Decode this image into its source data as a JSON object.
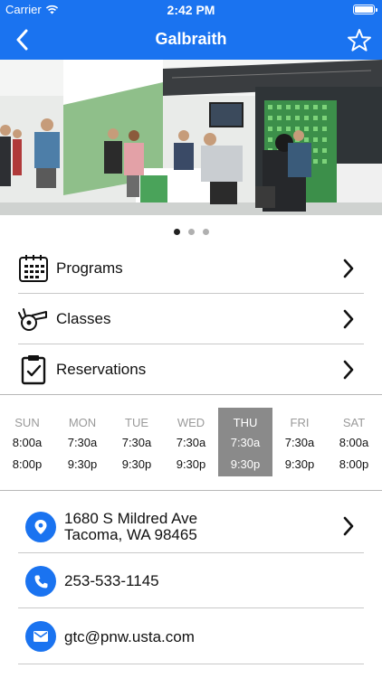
{
  "status_bar": {
    "carrier": "Carrier",
    "time": "2:42 PM"
  },
  "nav": {
    "title": "Galbraith",
    "back_icon": "chevron-left-icon",
    "favorite_icon": "star-outline-icon"
  },
  "gallery": {
    "photo_count": 3,
    "active_index": 0
  },
  "menu": [
    {
      "label": "Programs",
      "icon": "calendar-icon"
    },
    {
      "label": "Classes",
      "icon": "whistle-icon"
    },
    {
      "label": "Reservations",
      "icon": "clipboard-check-icon"
    }
  ],
  "hours": [
    {
      "day": "SUN",
      "open": "8:00a",
      "close": "8:00p"
    },
    {
      "day": "MON",
      "open": "7:30a",
      "close": "9:30p"
    },
    {
      "day": "TUE",
      "open": "7:30a",
      "close": "9:30p"
    },
    {
      "day": "WED",
      "open": "7:30a",
      "close": "9:30p"
    },
    {
      "day": "THU",
      "open": "7:30a",
      "close": "9:30p"
    },
    {
      "day": "FRI",
      "open": "7:30a",
      "close": "9:30p"
    },
    {
      "day": "SAT",
      "open": "8:00a",
      "close": "8:00p"
    }
  ],
  "hours_today_index": 4,
  "contact": {
    "address_line1": "1680 S Mildred Ave",
    "address_line2": "Tacoma, WA 98465",
    "phone": "253-533-1145",
    "email": "gtc@pnw.usta.com"
  },
  "colors": {
    "accent": "#1a73f0",
    "today_bg": "#8a8a8a"
  }
}
